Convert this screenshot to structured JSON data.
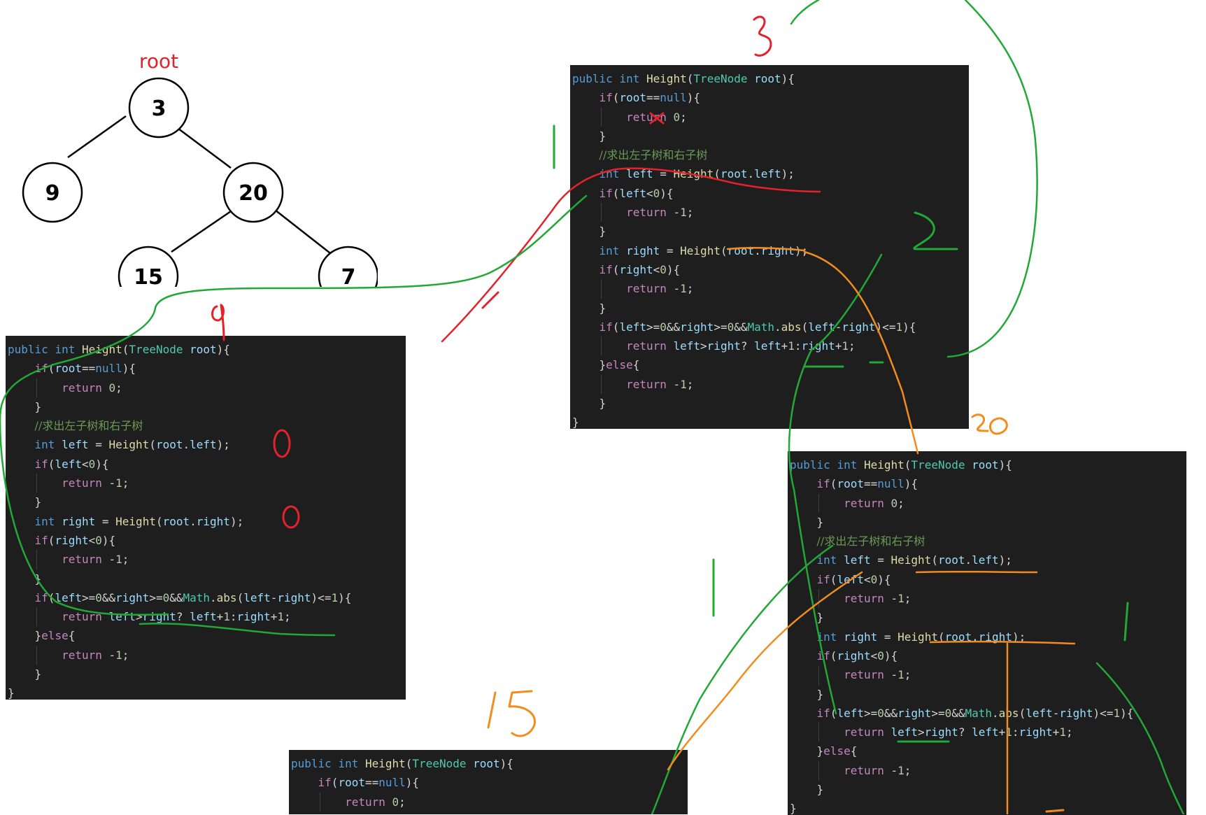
{
  "tree": {
    "root_label": "root",
    "nodes": [
      {
        "id": "n3",
        "label": "3"
      },
      {
        "id": "n9",
        "label": "9"
      },
      {
        "id": "n20",
        "label": "20"
      },
      {
        "id": "n15",
        "label": "15"
      },
      {
        "id": "n7",
        "label": "7"
      }
    ]
  },
  "code": {
    "lines": [
      "public int Height(TreeNode root){",
      "    if(root==null){",
      "        return 0;",
      "    }",
      "    //求出左子树和右子树",
      "    int left = Height(root.left);",
      "    if(left<0){",
      "        return -1;",
      "    }",
      "    int right = Height(root.right);",
      "    if(right<0){",
      "        return -1;",
      "    }",
      "    if(left>=0&&right>=0&&Math.abs(left-right)<=1){",
      "        return left>right? left+1:right+1;",
      "    }else{",
      "        return -1;",
      "    }",
      "}"
    ]
  },
  "panels": [
    {
      "id": "panel-node-9",
      "annotation": "9",
      "visible_lines": 19
    },
    {
      "id": "panel-node-3",
      "annotation": "3",
      "visible_lines": 19
    },
    {
      "id": "panel-node-20",
      "annotation": "20",
      "visible_lines": 19
    },
    {
      "id": "panel-node-15",
      "annotation": "15",
      "visible_lines": 4
    }
  ],
  "annotations": {
    "return_values": [
      "0",
      "0"
    ],
    "step_marks": [
      "1",
      "2",
      "1",
      "1"
    ],
    "colors": {
      "red": "#e3222b",
      "green": "#22a836",
      "orange": "#f28c1e"
    }
  }
}
